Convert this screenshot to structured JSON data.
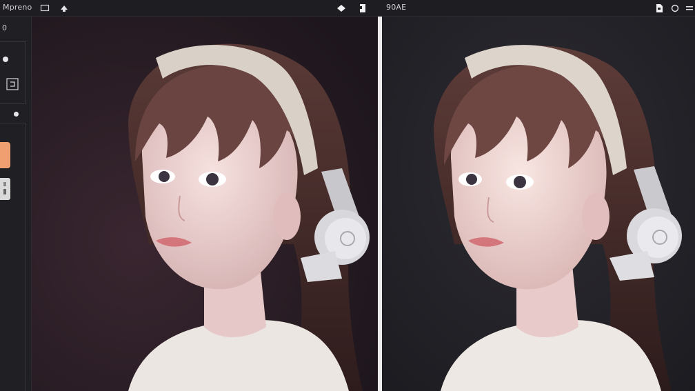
{
  "app": {
    "title": "Mpreno",
    "right_title": "90AE"
  },
  "toolbar": {
    "icons": [
      "panel-icon",
      "pointer-icon",
      "diamond-icon",
      "bookmark-icon",
      "document-icon",
      "circle-icon",
      "menu-icon"
    ]
  },
  "sidebar": {
    "top_label": "0",
    "accent_color": "#f0a070"
  },
  "canvas": {
    "left_background": "#2a1e26",
    "right_background": "#1f1f25"
  }
}
